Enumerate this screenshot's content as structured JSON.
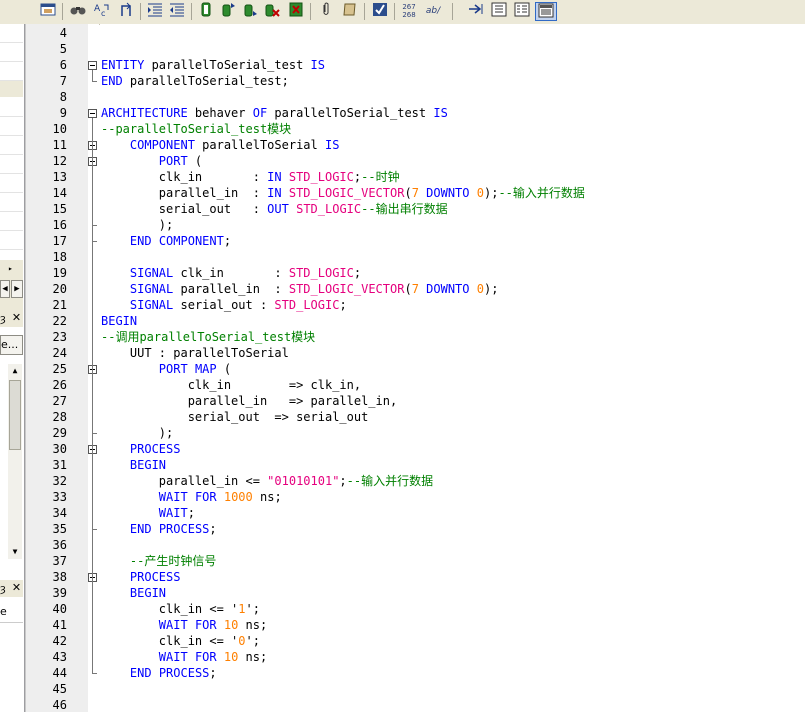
{
  "toolbar": {
    "icons": [
      "window-icon",
      "find-icon",
      "find-replace-icon",
      "goto-icon",
      "indent-icon",
      "outdent-icon",
      "bookmark-icon",
      "bookmark-prev-icon",
      "bookmark-next-icon",
      "bookmark-clear-icon",
      "clear-icon",
      "attach-icon",
      "scroll-icon",
      "spellcheck-icon",
      "line-numbers-icon",
      "word-wrap-icon",
      "arrow-right-icon",
      "list-icon",
      "list-alt-icon",
      "panel-icon"
    ],
    "line_numbers_label_top": "267",
    "line_numbers_label_bottom": "268",
    "word_wrap_label": "ab/"
  },
  "left_panel": {
    "close_glyph": "✕",
    "tab1_label": "ȝ",
    "button_label": "e...",
    "tab2_label": "ȝ",
    "item_label": "e"
  },
  "editor": {
    "lines": [
      {
        "n": "4",
        "segs": []
      },
      {
        "n": "5",
        "segs": []
      },
      {
        "n": "6",
        "segs": [
          {
            "t": "ENTITY",
            "c": "kw"
          },
          {
            "t": " parallelToSerial_test ",
            "c": ""
          },
          {
            "t": "IS",
            "c": "kw"
          }
        ]
      },
      {
        "n": "7",
        "segs": [
          {
            "t": "END",
            "c": "kw"
          },
          {
            "t": " parallelToSerial_test;",
            "c": ""
          }
        ]
      },
      {
        "n": "8",
        "segs": []
      },
      {
        "n": "9",
        "segs": [
          {
            "t": "ARCHITECTURE",
            "c": "kw"
          },
          {
            "t": " behaver ",
            "c": ""
          },
          {
            "t": "OF",
            "c": "kw"
          },
          {
            "t": " parallelToSerial_test ",
            "c": ""
          },
          {
            "t": "IS",
            "c": "kw"
          }
        ]
      },
      {
        "n": "10",
        "segs": [
          {
            "t": "--parallelToSerial_test模块",
            "c": "cm"
          }
        ]
      },
      {
        "n": "11",
        "segs": [
          {
            "t": "    ",
            "c": ""
          },
          {
            "t": "COMPONENT",
            "c": "kw"
          },
          {
            "t": " parallelToSerial ",
            "c": ""
          },
          {
            "t": "IS",
            "c": "kw"
          }
        ]
      },
      {
        "n": "12",
        "segs": [
          {
            "t": "        ",
            "c": ""
          },
          {
            "t": "PORT",
            "c": "kw"
          },
          {
            "t": " (",
            "c": ""
          }
        ]
      },
      {
        "n": "13",
        "segs": [
          {
            "t": "        clk_in       : ",
            "c": ""
          },
          {
            "t": "IN",
            "c": "kw"
          },
          {
            "t": " ",
            "c": ""
          },
          {
            "t": "STD_LOGIC",
            "c": "ty"
          },
          {
            "t": ";",
            "c": ""
          },
          {
            "t": "--时钟",
            "c": "cm"
          }
        ]
      },
      {
        "n": "14",
        "segs": [
          {
            "t": "        parallel_in  : ",
            "c": ""
          },
          {
            "t": "IN",
            "c": "kw"
          },
          {
            "t": " ",
            "c": ""
          },
          {
            "t": "STD_LOGIC_VECTOR",
            "c": "ty"
          },
          {
            "t": "(",
            "c": ""
          },
          {
            "t": "7",
            "c": "num"
          },
          {
            "t": " ",
            "c": ""
          },
          {
            "t": "DOWNTO",
            "c": "kw"
          },
          {
            "t": " ",
            "c": ""
          },
          {
            "t": "0",
            "c": "num"
          },
          {
            "t": ");",
            "c": ""
          },
          {
            "t": "--输入并行数据",
            "c": "cm"
          }
        ]
      },
      {
        "n": "15",
        "segs": [
          {
            "t": "        serial_out   : ",
            "c": ""
          },
          {
            "t": "OUT",
            "c": "kw"
          },
          {
            "t": " ",
            "c": ""
          },
          {
            "t": "STD_LOGIC",
            "c": "ty"
          },
          {
            "t": "--输出串行数据",
            "c": "cm"
          }
        ]
      },
      {
        "n": "16",
        "segs": [
          {
            "t": "        );",
            "c": ""
          }
        ]
      },
      {
        "n": "17",
        "segs": [
          {
            "t": "    ",
            "c": ""
          },
          {
            "t": "END",
            "c": "kw"
          },
          {
            "t": " ",
            "c": ""
          },
          {
            "t": "COMPONENT",
            "c": "kw"
          },
          {
            "t": ";",
            "c": ""
          }
        ]
      },
      {
        "n": "18",
        "segs": []
      },
      {
        "n": "19",
        "segs": [
          {
            "t": "    ",
            "c": ""
          },
          {
            "t": "SIGNAL",
            "c": "kw"
          },
          {
            "t": " clk_in       : ",
            "c": ""
          },
          {
            "t": "STD_LOGIC",
            "c": "ty"
          },
          {
            "t": ";",
            "c": ""
          }
        ]
      },
      {
        "n": "20",
        "segs": [
          {
            "t": "    ",
            "c": ""
          },
          {
            "t": "SIGNAL",
            "c": "kw"
          },
          {
            "t": " parallel_in  : ",
            "c": ""
          },
          {
            "t": "STD_LOGIC_VECTOR",
            "c": "ty"
          },
          {
            "t": "(",
            "c": ""
          },
          {
            "t": "7",
            "c": "num"
          },
          {
            "t": " ",
            "c": ""
          },
          {
            "t": "DOWNTO",
            "c": "kw"
          },
          {
            "t": " ",
            "c": ""
          },
          {
            "t": "0",
            "c": "num"
          },
          {
            "t": ");",
            "c": ""
          }
        ]
      },
      {
        "n": "21",
        "segs": [
          {
            "t": "    ",
            "c": ""
          },
          {
            "t": "SIGNAL",
            "c": "kw"
          },
          {
            "t": " serial_out : ",
            "c": ""
          },
          {
            "t": "STD_LOGIC",
            "c": "ty"
          },
          {
            "t": ";",
            "c": ""
          }
        ]
      },
      {
        "n": "22",
        "segs": [
          {
            "t": "BEGIN",
            "c": "kw"
          }
        ]
      },
      {
        "n": "23",
        "segs": [
          {
            "t": "--调用parallelToSerial_test模块",
            "c": "cm"
          }
        ]
      },
      {
        "n": "24",
        "segs": [
          {
            "t": "    UUT : parallelToSerial",
            "c": ""
          }
        ]
      },
      {
        "n": "25",
        "segs": [
          {
            "t": "        ",
            "c": ""
          },
          {
            "t": "PORT",
            "c": "kw"
          },
          {
            "t": " ",
            "c": ""
          },
          {
            "t": "MAP",
            "c": "kw"
          },
          {
            "t": " (",
            "c": ""
          }
        ]
      },
      {
        "n": "26",
        "segs": [
          {
            "t": "            clk_in        => clk_in,",
            "c": ""
          }
        ]
      },
      {
        "n": "27",
        "segs": [
          {
            "t": "            parallel_in   => parallel_in,",
            "c": ""
          }
        ]
      },
      {
        "n": "28",
        "segs": [
          {
            "t": "            serial_out  => serial_out",
            "c": ""
          }
        ]
      },
      {
        "n": "29",
        "segs": [
          {
            "t": "        );",
            "c": ""
          }
        ]
      },
      {
        "n": "30",
        "segs": [
          {
            "t": "    ",
            "c": ""
          },
          {
            "t": "PROCESS",
            "c": "kw"
          }
        ]
      },
      {
        "n": "31",
        "segs": [
          {
            "t": "    ",
            "c": ""
          },
          {
            "t": "BEGIN",
            "c": "kw"
          }
        ]
      },
      {
        "n": "32",
        "segs": [
          {
            "t": "        parallel_in <= ",
            "c": ""
          },
          {
            "t": "\"01010101\"",
            "c": "ty"
          },
          {
            "t": ";",
            "c": ""
          },
          {
            "t": "--输入并行数据",
            "c": "cm"
          }
        ]
      },
      {
        "n": "33",
        "segs": [
          {
            "t": "        ",
            "c": ""
          },
          {
            "t": "WAIT",
            "c": "kw"
          },
          {
            "t": " ",
            "c": ""
          },
          {
            "t": "FOR",
            "c": "kw"
          },
          {
            "t": " ",
            "c": ""
          },
          {
            "t": "1000",
            "c": "num"
          },
          {
            "t": " ns;",
            "c": ""
          }
        ]
      },
      {
        "n": "34",
        "segs": [
          {
            "t": "        ",
            "c": ""
          },
          {
            "t": "WAIT",
            "c": "kw"
          },
          {
            "t": ";",
            "c": ""
          }
        ]
      },
      {
        "n": "35",
        "segs": [
          {
            "t": "    ",
            "c": ""
          },
          {
            "t": "END",
            "c": "kw"
          },
          {
            "t": " ",
            "c": ""
          },
          {
            "t": "PROCESS",
            "c": "kw"
          },
          {
            "t": ";",
            "c": ""
          }
        ]
      },
      {
        "n": "36",
        "segs": []
      },
      {
        "n": "37",
        "segs": [
          {
            "t": "    ",
            "c": ""
          },
          {
            "t": "--产生时钟信号",
            "c": "cm"
          }
        ]
      },
      {
        "n": "38",
        "segs": [
          {
            "t": "    ",
            "c": ""
          },
          {
            "t": "PROCESS",
            "c": "kw"
          }
        ]
      },
      {
        "n": "39",
        "segs": [
          {
            "t": "    ",
            "c": ""
          },
          {
            "t": "BEGIN",
            "c": "kw"
          }
        ]
      },
      {
        "n": "40",
        "segs": [
          {
            "t": "        clk_in <= ",
            "c": ""
          },
          {
            "t": "'",
            "c": ""
          },
          {
            "t": "1",
            "c": "num"
          },
          {
            "t": "';",
            "c": ""
          }
        ]
      },
      {
        "n": "41",
        "segs": [
          {
            "t": "        ",
            "c": ""
          },
          {
            "t": "WAIT",
            "c": "kw"
          },
          {
            "t": " ",
            "c": ""
          },
          {
            "t": "FOR",
            "c": "kw"
          },
          {
            "t": " ",
            "c": ""
          },
          {
            "t": "10",
            "c": "num"
          },
          {
            "t": " ns;",
            "c": ""
          }
        ]
      },
      {
        "n": "42",
        "segs": [
          {
            "t": "        clk_in <= ",
            "c": ""
          },
          {
            "t": "'",
            "c": ""
          },
          {
            "t": "0",
            "c": "num"
          },
          {
            "t": "';",
            "c": ""
          }
        ]
      },
      {
        "n": "43",
        "segs": [
          {
            "t": "        ",
            "c": ""
          },
          {
            "t": "WAIT",
            "c": "kw"
          },
          {
            "t": " ",
            "c": ""
          },
          {
            "t": "FOR",
            "c": "kw"
          },
          {
            "t": " ",
            "c": ""
          },
          {
            "t": "10",
            "c": "num"
          },
          {
            "t": " ns;",
            "c": ""
          }
        ]
      },
      {
        "n": "44",
        "segs": [
          {
            "t": "    ",
            "c": ""
          },
          {
            "t": "END",
            "c": "kw"
          },
          {
            "t": " ",
            "c": ""
          },
          {
            "t": "PROCESS",
            "c": "kw"
          },
          {
            "t": ";",
            "c": ""
          }
        ]
      },
      {
        "n": "45",
        "segs": []
      },
      {
        "n": "46",
        "segs": []
      }
    ],
    "fold_markers": [
      "6",
      "9",
      "11",
      "12",
      "25",
      "30",
      "38"
    ]
  }
}
